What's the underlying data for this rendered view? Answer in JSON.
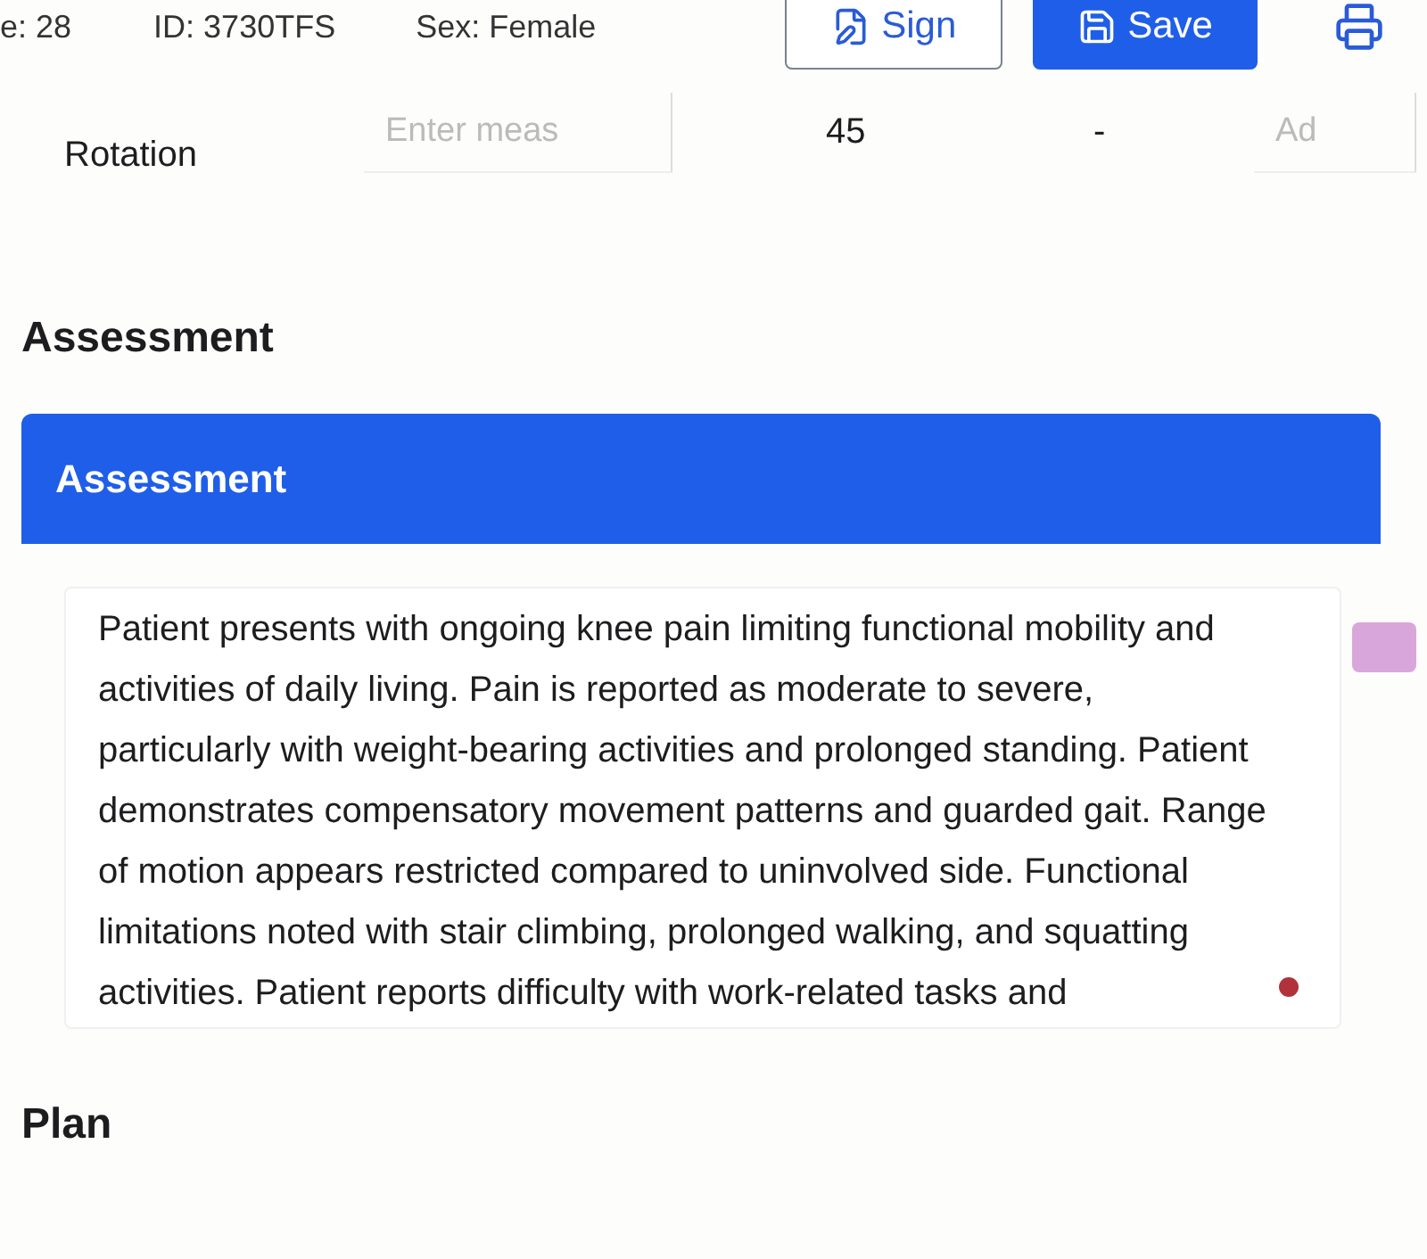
{
  "patient_bar": {
    "fields": [
      "e: 28",
      "ID: 3730TFS",
      "Sex: Female"
    ]
  },
  "actions": [
    {
      "kind": "outline",
      "label": "Sign"
    },
    {
      "kind": "primary",
      "label": "Save"
    },
    {
      "kind": "print"
    }
  ],
  "measurement_row": {
    "label": "Rotation",
    "measurement_placeholder": "Enter meas",
    "value": "45",
    "column_4": "-",
    "notes_placeholder": "Ad"
  },
  "sections": [
    {
      "heading": "Assessment",
      "panel_title": "Assessment",
      "text": "Patient presents with ongoing knee pain limiting functional mobility and activities of daily living. Pain is reported as moderate to severe, particularly with weight-bearing activities and prolonged standing. Patient demonstrates compensatory movement patterns and guarded gait. Range of motion appears restricted compared to uninvolved side. Functional limitations noted with stair climbing, prolonged walking, and squatting activities. Patient reports difficulty with work-related tasks and"
    },
    {
      "heading": "Plan"
    }
  ]
}
